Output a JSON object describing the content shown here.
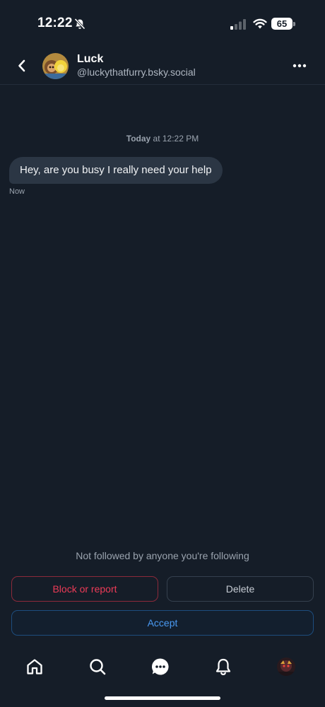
{
  "status_bar": {
    "time": "12:22",
    "battery": "65",
    "icons": [
      "bell-slash-icon",
      "cellular-signal-icon",
      "wifi-icon",
      "battery-icon"
    ]
  },
  "header": {
    "name": "Luck",
    "handle": "@luckythatfurry.bsky.social",
    "icons": [
      "chevron-left-icon",
      "avatar",
      "ellipsis-icon"
    ]
  },
  "conversation": {
    "date_day": "Today",
    "date_rest": " at 12:22 PM",
    "messages": [
      {
        "text": "Hey, are you busy I really need your help",
        "time": "Now"
      }
    ]
  },
  "request": {
    "notice": "Not followed by anyone you're following",
    "block_label": "Block or report",
    "delete_label": "Delete",
    "accept_label": "Accept"
  },
  "nav": {
    "items": [
      "home-icon",
      "search-icon",
      "chat-icon",
      "bell-icon",
      "profile-avatar"
    ]
  },
  "colors": {
    "background": "#151d28",
    "bubble": "#2b3644",
    "danger": "#ec3b57",
    "accent": "#4a9af2"
  }
}
